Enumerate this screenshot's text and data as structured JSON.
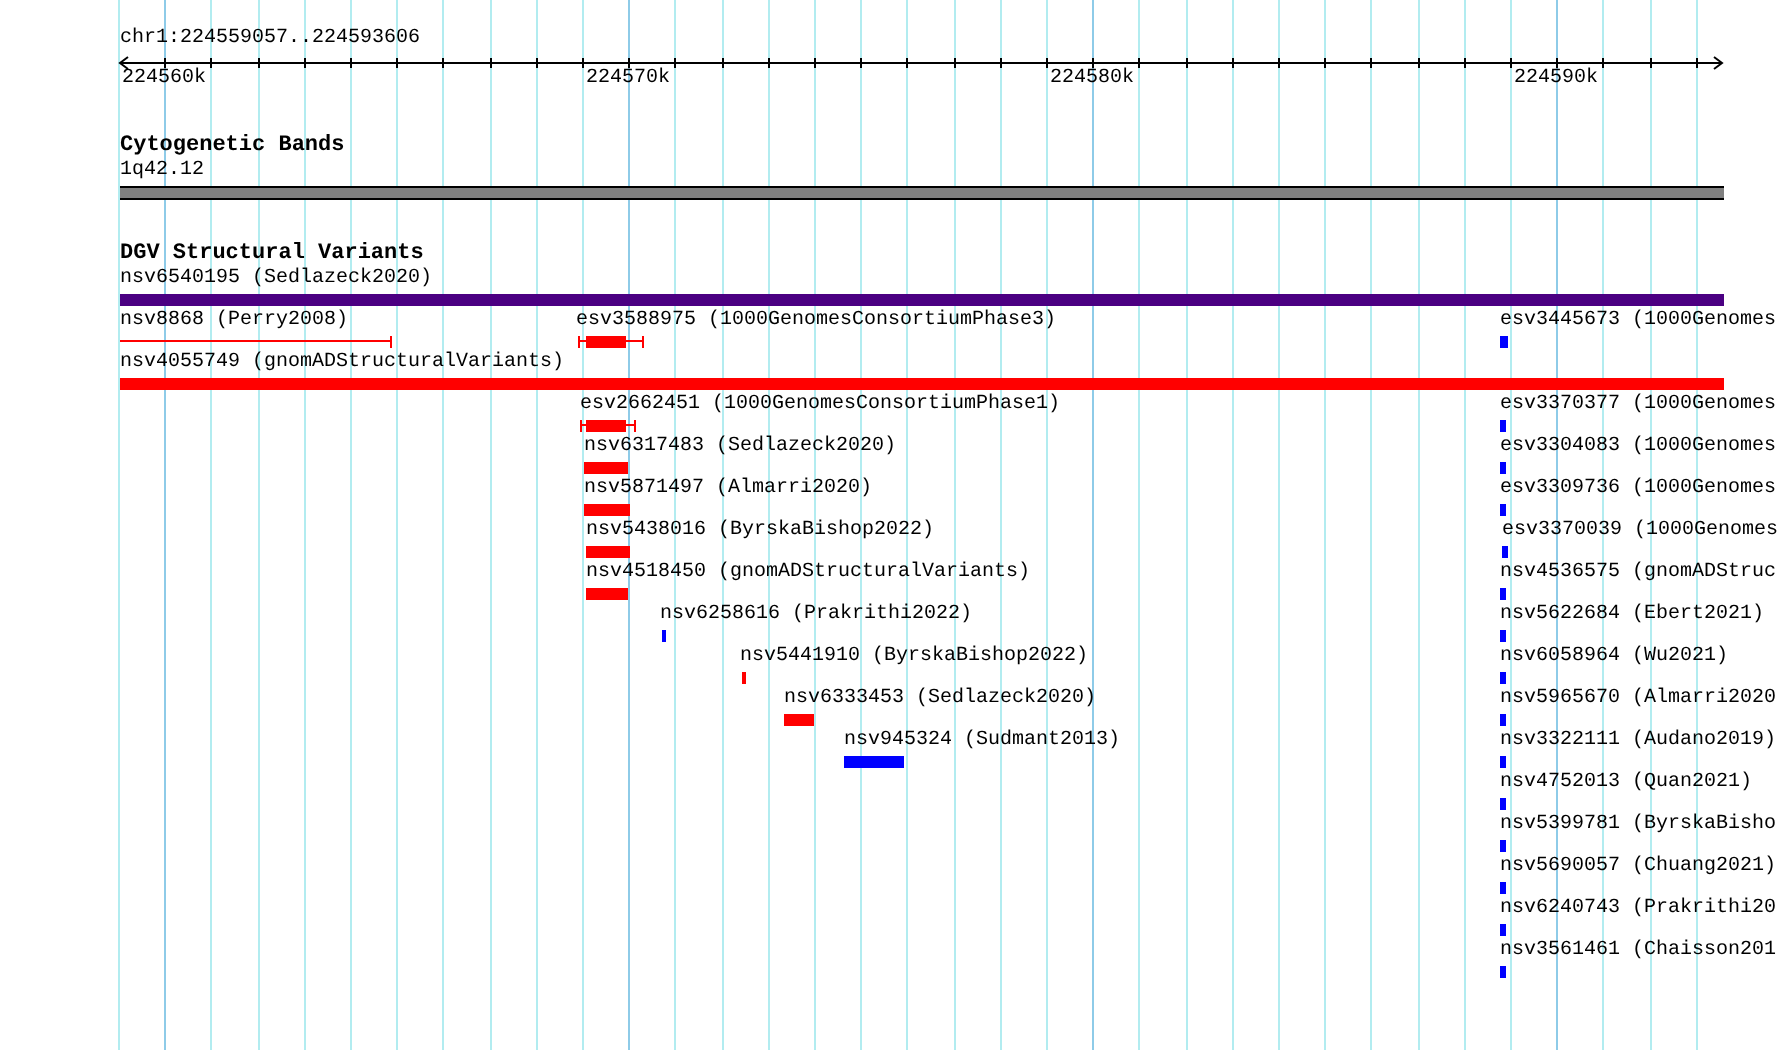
{
  "location": "chr1:224559057..224593606",
  "axis": {
    "ticks": [
      "224560k",
      "224570k",
      "224580k",
      "224590k"
    ]
  },
  "bands": {
    "title": "Cytogenetic Bands",
    "label": "1q42.12"
  },
  "variants": {
    "title": "DGV Structural Variants",
    "features": [
      {
        "label": "nsv6540195 (Sedlazeck2020)",
        "kind": "bar",
        "color": "#4b0082"
      },
      {
        "label": "nsv8868 (Perry2008)",
        "kind": "line",
        "color": "#ff0000"
      },
      {
        "label": "esv3588975 (1000GenomesConsortiumPhase3)",
        "kind": "capped",
        "color": "#ff0000"
      },
      {
        "label": "esv3445673 (1000Genomes",
        "kind": "bar",
        "color": "#0000ff"
      },
      {
        "label": "nsv4055749 (gnomADStructuralVariants)",
        "kind": "bar",
        "color": "#ff0000"
      },
      {
        "label": "esv2662451 (1000GenomesConsortiumPhase1)",
        "kind": "capped",
        "color": "#ff0000"
      },
      {
        "label": "esv3370377 (1000Genomes",
        "kind": "bar",
        "color": "#0000ff"
      },
      {
        "label": "nsv6317483 (Sedlazeck2020)",
        "kind": "bar",
        "color": "#ff0000"
      },
      {
        "label": "esv3304083 (1000Genomes",
        "kind": "bar",
        "color": "#0000ff"
      },
      {
        "label": "nsv5871497 (Almarri2020)",
        "kind": "bar",
        "color": "#ff0000"
      },
      {
        "label": "esv3309736 (1000Genomes",
        "kind": "bar",
        "color": "#0000ff"
      },
      {
        "label": "nsv5438016 (ByrskaBishop2022)",
        "kind": "bar",
        "color": "#ff0000"
      },
      {
        "label": "esv3370039 (1000Genomes",
        "kind": "bar",
        "color": "#0000ff"
      },
      {
        "label": "nsv4518450 (gnomADStructuralVariants)",
        "kind": "bar",
        "color": "#ff0000"
      },
      {
        "label": "nsv4536575 (gnomADStruc",
        "kind": "bar",
        "color": "#0000ff"
      },
      {
        "label": "nsv6258616 (Prakrithi2022)",
        "kind": "bar",
        "color": "#0000ff"
      },
      {
        "label": "nsv5622684 (Ebert2021)",
        "kind": "bar",
        "color": "#0000ff"
      },
      {
        "label": "nsv5441910 (ByrskaBishop2022)",
        "kind": "bar",
        "color": "#ff0000"
      },
      {
        "label": "nsv6058964 (Wu2021)",
        "kind": "bar",
        "color": "#0000ff"
      },
      {
        "label": "nsv6333453 (Sedlazeck2020)",
        "kind": "bar",
        "color": "#ff0000"
      },
      {
        "label": "nsv5965670 (Almarri2020",
        "kind": "bar",
        "color": "#0000ff"
      },
      {
        "label": "nsv945324 (Sudmant2013)",
        "kind": "bar",
        "color": "#0000ff"
      },
      {
        "label": "nsv3322111 (Audano2019)",
        "kind": "bar",
        "color": "#0000ff"
      },
      {
        "label": "nsv4752013 (Quan2021)",
        "kind": "bar",
        "color": "#0000ff"
      },
      {
        "label": "nsv5399781 (ByrskaBisho",
        "kind": "bar",
        "color": "#0000ff"
      },
      {
        "label": "nsv5690057 (Chuang2021)",
        "kind": "bar",
        "color": "#0000ff"
      },
      {
        "label": "nsv6240743 (Prakrithi20",
        "kind": "bar",
        "color": "#0000ff"
      },
      {
        "label": "nsv3561461 (Chaisson201",
        "kind": "bar",
        "color": "#0000ff"
      }
    ]
  }
}
